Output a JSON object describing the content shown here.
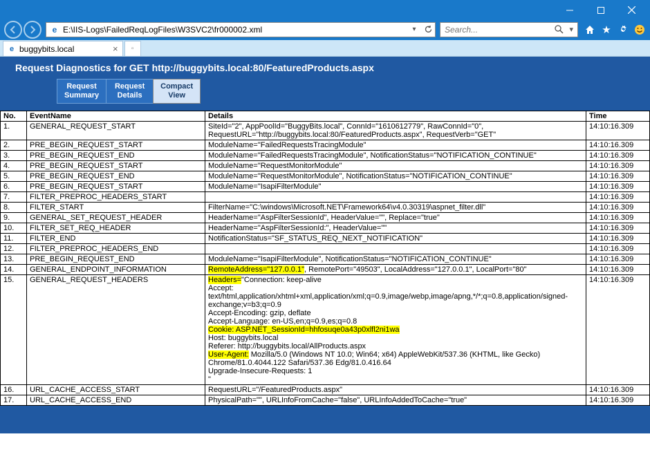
{
  "window": {
    "url": "E:\\IIS-Logs\\FailedReqLogFiles\\W3SVC2\\fr000002.xml",
    "search_placeholder": "Search..."
  },
  "tab": {
    "title": "buggybits.local"
  },
  "page": {
    "title": "Request Diagnostics for GET http://buggybits.local:80/FeaturedProducts.aspx",
    "tabs": {
      "summary": "Request\nSummary",
      "details": "Request\nDetails",
      "compact": "Compact\nView"
    }
  },
  "grid": {
    "headers": {
      "no": "No.",
      "event": "EventName",
      "details": "Details",
      "time": "Time"
    },
    "rows": [
      {
        "no": "1.",
        "ev": "GENERAL_REQUEST_START",
        "time": "14:10:16.309",
        "det": [
          {
            "t": "SiteId=\"2\", AppPoolId=\"BuggyBits.local\", ConnId=\"1610612779\", RawConnId=\"0\", RequestURL=\"http://buggybits.local:80/FeaturedProducts.aspx\", RequestVerb=\"GET\""
          }
        ]
      },
      {
        "no": "2.",
        "ev": "PRE_BEGIN_REQUEST_START",
        "time": "14:10:16.309",
        "det": [
          {
            "t": "ModuleName=\"FailedRequestsTracingModule\""
          }
        ]
      },
      {
        "no": "3.",
        "ev": "PRE_BEGIN_REQUEST_END",
        "time": "14:10:16.309",
        "det": [
          {
            "t": "ModuleName=\"FailedRequestsTracingModule\", NotificationStatus=\"NOTIFICATION_CONTINUE\""
          }
        ]
      },
      {
        "no": "4.",
        "ev": "PRE_BEGIN_REQUEST_START",
        "time": "14:10:16.309",
        "det": [
          {
            "t": "ModuleName=\"RequestMonitorModule\""
          }
        ]
      },
      {
        "no": "5.",
        "ev": "PRE_BEGIN_REQUEST_END",
        "time": "14:10:16.309",
        "det": [
          {
            "t": "ModuleName=\"RequestMonitorModule\", NotificationStatus=\"NOTIFICATION_CONTINUE\""
          }
        ]
      },
      {
        "no": "6.",
        "ev": "PRE_BEGIN_REQUEST_START",
        "time": "14:10:16.309",
        "det": [
          {
            "t": "ModuleName=\"IsapiFilterModule\""
          }
        ]
      },
      {
        "no": "7.",
        "ev": "FILTER_PREPROC_HEADERS_START",
        "time": "14:10:16.309",
        "det": [
          {
            "t": ""
          }
        ]
      },
      {
        "no": "8.",
        "ev": "FILTER_START",
        "time": "14:10:16.309",
        "det": [
          {
            "t": "FilterName=\"C:\\windows\\Microsoft.NET\\Framework64\\v4.0.30319\\aspnet_filter.dll\""
          }
        ]
      },
      {
        "no": "9.",
        "ev": "GENERAL_SET_REQUEST_HEADER",
        "time": "14:10:16.309",
        "det": [
          {
            "t": "HeaderName=\"AspFilterSessionId\", HeaderValue=\"\", Replace=\"true\""
          }
        ]
      },
      {
        "no": "10.",
        "ev": "FILTER_SET_REQ_HEADER",
        "time": "14:10:16.309",
        "det": [
          {
            "t": "HeaderName=\"AspFilterSessionId:\", HeaderValue=\"\""
          }
        ]
      },
      {
        "no": "11.",
        "ev": "FILTER_END",
        "time": "14:10:16.309",
        "det": [
          {
            "t": "NotificationStatus=\"SF_STATUS_REQ_NEXT_NOTIFICATION\""
          }
        ]
      },
      {
        "no": "12.",
        "ev": "FILTER_PREPROC_HEADERS_END",
        "time": "14:10:16.309",
        "det": [
          {
            "t": ""
          }
        ]
      },
      {
        "no": "13.",
        "ev": "PRE_BEGIN_REQUEST_END",
        "time": "14:10:16.309",
        "det": [
          {
            "t": "ModuleName=\"IsapiFilterModule\", NotificationStatus=\"NOTIFICATION_CONTINUE\""
          }
        ]
      },
      {
        "no": "14.",
        "ev": "GENERAL_ENDPOINT_INFORMATION",
        "time": "14:10:16.309",
        "det": [
          {
            "t": "RemoteAddress=\"127.0.0.1\"",
            "hl": true
          },
          {
            "t": ", RemotePort=\"49503\", LocalAddress=\"127.0.0.1\", LocalPort=\"80\""
          }
        ]
      },
      {
        "no": "15.",
        "ev": "GENERAL_REQUEST_HEADERS",
        "time": "14:10:16.309",
        "det": [
          {
            "t": "Headers=",
            "hl": true
          },
          {
            "t": "\"Connection: keep-alive"
          },
          {
            "br": true
          },
          {
            "t": "Accept: text/html,application/xhtml+xml,application/xml;q=0.9,image/webp,image/apng,*/*;q=0.8,application/signed-exchange;v=b3;q=0.9"
          },
          {
            "br": true
          },
          {
            "t": "Accept-Encoding: gzip, deflate"
          },
          {
            "br": true
          },
          {
            "t": "Accept-Language: en-US,en;q=0.9,es;q=0.8"
          },
          {
            "br": true
          },
          {
            "t": "Cookie: ASP.NET_SessionId=hhfosuqe0a43p0xlfl2ni1wa",
            "hl": true
          },
          {
            "br": true
          },
          {
            "t": "Host: buggybits.local"
          },
          {
            "br": true
          },
          {
            "t": "Referer: http://buggybits.local/AllProducts.aspx"
          },
          {
            "br": true
          },
          {
            "t": "User-Agent:",
            "hl": true
          },
          {
            "t": " Mozilla/5.0 (Windows NT 10.0; Win64; x64) AppleWebKit/537.36 (KHTML, like Gecko) Chrome/81.0.4044.122 Safari/537.36 Edg/81.0.416.64"
          },
          {
            "br": true
          },
          {
            "t": "Upgrade-Insecure-Requests: 1"
          },
          {
            "br": true
          },
          {
            "t": "\""
          }
        ]
      },
      {
        "no": "16.",
        "ev": "URL_CACHE_ACCESS_START",
        "time": "14:10:16.309",
        "det": [
          {
            "t": "RequestURL=\"/FeaturedProducts.aspx\""
          }
        ]
      },
      {
        "no": "17.",
        "ev": "URL_CACHE_ACCESS_END",
        "time": "14:10:16.309",
        "det": [
          {
            "t": "PhysicalPath=\"\", URLInfoFromCache=\"false\", URLInfoAddedToCache=\"true\""
          }
        ]
      }
    ]
  }
}
